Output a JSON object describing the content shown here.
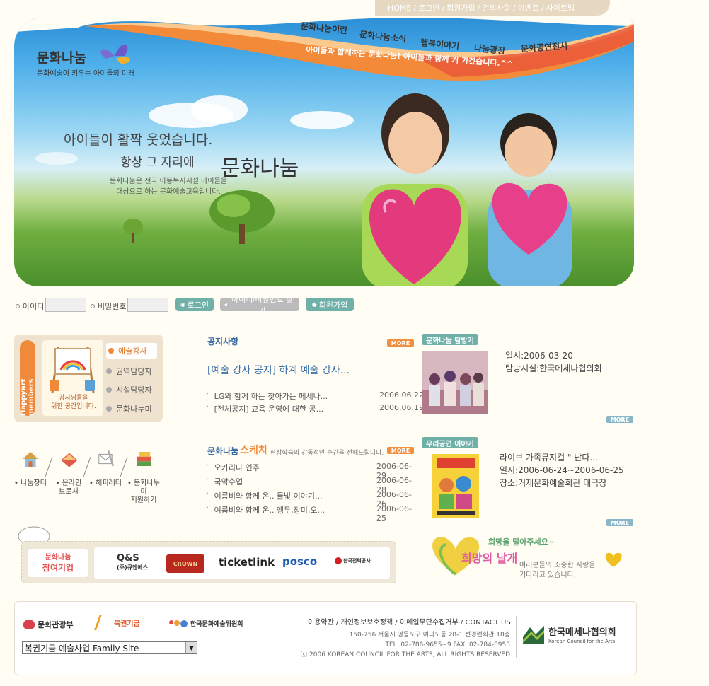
{
  "top_util": {
    "items": [
      "HOME",
      "로그인",
      "회원가입",
      "건의사항",
      "이벤트",
      "사이트맵"
    ],
    "sep": "/"
  },
  "hero": {
    "logo_title": "문화나눔",
    "logo_sub": "문화예술이 키우는 아이들의 미래",
    "menu": [
      "문화나눔이란",
      "문화나눔소식",
      "행복이야기",
      "나눔광장",
      "문화공연전시"
    ],
    "slogan": "아이들과 함께하는 문화나눔! 아이들과 함께 커 가겠습니다.^^",
    "hand1": "아이들이 활짝 웃었습니다.",
    "hand2": "항상 그 자리에",
    "hand3": "문화나눔",
    "desc_line1": "문화나눔은 전국 아동복지시설 아이들을",
    "desc_line2": "대상으로 하는 문화예술교육입니다."
  },
  "login": {
    "id_label": "아이디",
    "pw_label": "비밀번호",
    "login_btn": "로그인",
    "find_btn": "아이디/비밀번호 찾기",
    "join_btn": "회원가입"
  },
  "members": {
    "tab": "Happyart members",
    "caption_line1": "강사님들을",
    "caption_line2": "위한 공간입니다.",
    "items": [
      "예술강사",
      "권역담당자",
      "시설담당자",
      "문화나누미"
    ]
  },
  "quick_icons": [
    {
      "line1": "나눔장터",
      "line2": ""
    },
    {
      "line1": "온라인",
      "line2": "브로셔"
    },
    {
      "line1": "해피레터",
      "line2": ""
    },
    {
      "line1": "문화나누미",
      "line2": "지원하기"
    }
  ],
  "notice": {
    "title": "공지사항",
    "more": "MORE",
    "headline": "[예술 강사 공지] 하계 예술 강사...",
    "rows": [
      {
        "text": "LG와 함께 하는 찾아가는 메세나...",
        "date": "2006.06.22"
      },
      {
        "text": "[전체공지] 교육 운영에 대한 공...",
        "date": "2006.06.19"
      }
    ]
  },
  "visit": {
    "tag": "문화나눔 탐방기",
    "date": "일시:2006-03-20",
    "place": "탐방시설:한국메세나협의회",
    "more": "MORE"
  },
  "sketch": {
    "title_a": "문화나눔",
    "title_b": "스케치",
    "desc": "현장학습의 감동적인 순간을 전해드립니다.",
    "more": "MORE",
    "rows": [
      {
        "text": "오카리나 연주",
        "date": "2006-06-29"
      },
      {
        "text": "국악수업",
        "date": "2006-06-28"
      },
      {
        "text": "여름비와 함께 온.. 물빛 이야기...",
        "date": "2006-06-26"
      },
      {
        "text": "여름비와 함께 온.. 앵두,장미,오...",
        "date": "2006-06-25"
      }
    ]
  },
  "performance": {
    "tag": "우리공연 이야기",
    "title": "라이브 가족뮤지컬 \" 난다...",
    "date": "일시:2006-06-24~2006-06-25",
    "place": "장소:거제문화예술회관 대극장",
    "more": "MORE"
  },
  "sponsors": {
    "label_line1": "문화나눔",
    "label_line2": "참여기업",
    "logos": [
      "Q&S",
      "(주)큐엔에스",
      "CROWN",
      "ticketlink",
      "posco",
      "한국전력공사"
    ]
  },
  "hope": {
    "line1": "희망을 달아주세요~",
    "line2": "희망의 날개",
    "line3": "여러분들의 소중한 사랑을",
    "line4": "기다리고 있습니다."
  },
  "footer": {
    "org1": "문화관광부",
    "org2": "복권기금",
    "org3": "한국문화예술위원회",
    "family_site": "복권기금 예술사업 Family Site",
    "links": [
      "이용약관",
      "개인정보보호정책",
      "이메일무단수집거부",
      "CONTACT US"
    ],
    "address": "150-756 서울시 영등포구 여의도동 28-1 전경련회관 18층",
    "phone": "TEL. 02-786-9655~9   FAX. 02-784-0953",
    "copyright": "ⓒ 2006 KOREAN COUNCIL FOR THE ARTS,  ALL RIGHTS RESERVED",
    "council_ko": "한국메세나협의회",
    "council_en": "Korean Council for the Arts"
  },
  "colors": {
    "accent_orange": "#f08a3a",
    "accent_teal": "#6fb0a8",
    "title_blue": "#3a6ea5"
  }
}
